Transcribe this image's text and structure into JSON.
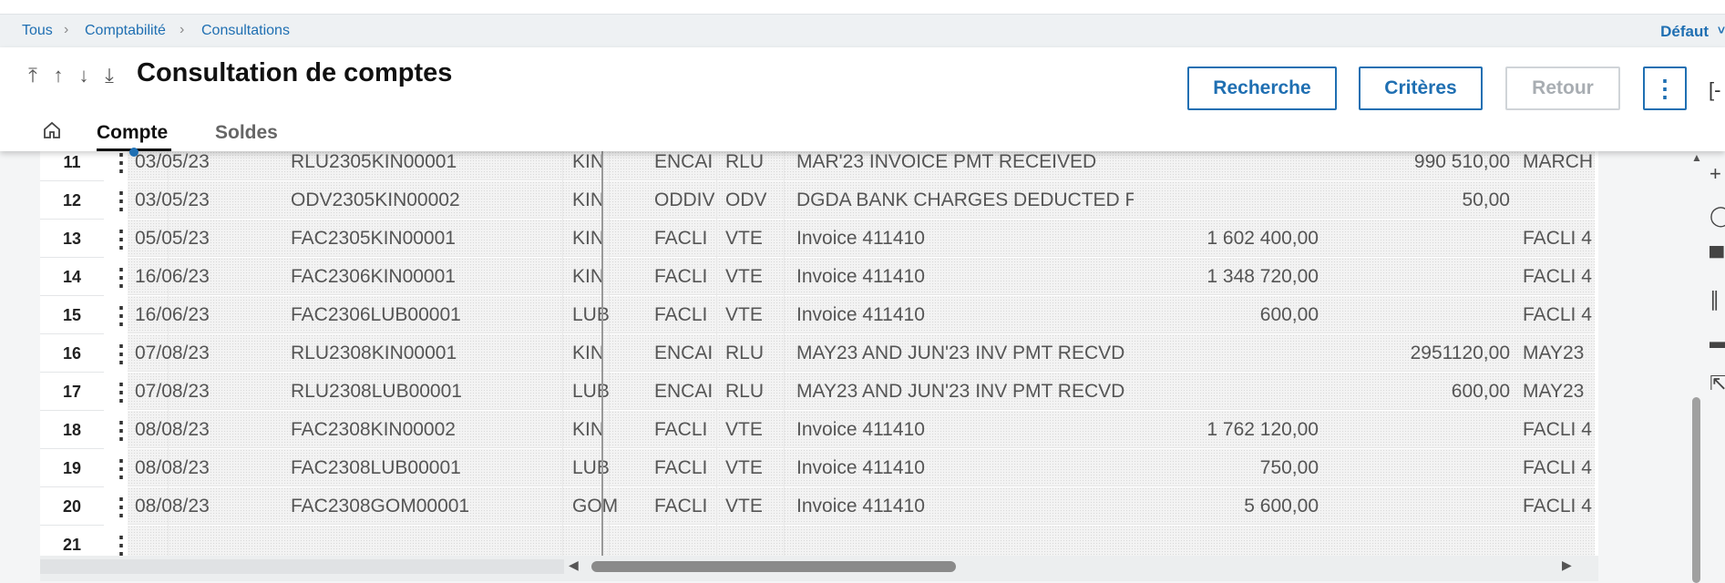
{
  "breadcrumb": [
    "Tous",
    "Comptabilité",
    "Consultations"
  ],
  "default_label": "Défaut",
  "page_title": "Consultation de comptes",
  "nav_arrows": [
    "⤒",
    "↑",
    "↓",
    "⤓"
  ],
  "buttons": {
    "search": "Recherche",
    "criteria": "Critères",
    "back": "Retour"
  },
  "tabs": [
    {
      "label": "Compte"
    },
    {
      "label": "Soldes"
    }
  ],
  "rows": [
    {
      "num": "11",
      "date": "03/05/23",
      "piece": "RLU2305KIN00001",
      "site": "KIN",
      "journal": "ENCAI",
      "type": "RLU",
      "label": "MAR'23 INVOICE PMT RECEIVED",
      "debit": "",
      "credit": "990 510,00",
      "ref": "MARCH"
    },
    {
      "num": "12",
      "date": "03/05/23",
      "piece": "ODV2305KIN00002",
      "site": "KIN",
      "journal": "ODDIV",
      "type": "ODV",
      "label": "DGDA BANK CHARGES DEDUCTED FR",
      "debit": "",
      "credit": "50,00",
      "ref": ""
    },
    {
      "num": "13",
      "date": "05/05/23",
      "piece": "FAC2305KIN00001",
      "site": "KIN",
      "journal": "FACLI",
      "type": "VTE",
      "label": "Invoice 411410",
      "debit": "1 602 400,00",
      "credit": "",
      "ref": "FACLI 4"
    },
    {
      "num": "14",
      "date": "16/06/23",
      "piece": "FAC2306KIN00001",
      "site": "KIN",
      "journal": "FACLI",
      "type": "VTE",
      "label": "Invoice 411410",
      "debit": "1 348 720,00",
      "credit": "",
      "ref": "FACLI 4"
    },
    {
      "num": "15",
      "date": "16/06/23",
      "piece": "FAC2306LUB00001",
      "site": "LUB",
      "journal": "FACLI",
      "type": "VTE",
      "label": "Invoice 411410",
      "debit": "600,00",
      "credit": "",
      "ref": "FACLI 4"
    },
    {
      "num": "16",
      "date": "07/08/23",
      "piece": "RLU2308KIN00001",
      "site": "KIN",
      "journal": "ENCAI",
      "type": "RLU",
      "label": "MAY23 AND JUN'23 INV PMT RECVD",
      "debit": "",
      "credit": "2951120,00",
      "ref": "MAY23"
    },
    {
      "num": "17",
      "date": "07/08/23",
      "piece": "RLU2308LUB00001",
      "site": "LUB",
      "journal": "ENCAI",
      "type": "RLU",
      "label": "MAY23 AND JUN'23 INV PMT RECVD",
      "debit": "",
      "credit": "600,00",
      "ref": "MAY23"
    },
    {
      "num": "18",
      "date": "08/08/23",
      "piece": "FAC2308KIN00002",
      "site": "KIN",
      "journal": "FACLI",
      "type": "VTE",
      "label": "Invoice 411410",
      "debit": "1 762 120,00",
      "credit": "",
      "ref": "FACLI 4"
    },
    {
      "num": "19",
      "date": "08/08/23",
      "piece": "FAC2308LUB00001",
      "site": "LUB",
      "journal": "FACLI",
      "type": "VTE",
      "label": "Invoice 411410",
      "debit": "750,00",
      "credit": "",
      "ref": "FACLI 4"
    },
    {
      "num": "20",
      "date": "08/08/23",
      "piece": "FAC2308GOM00001",
      "site": "GOM",
      "journal": "FACLI",
      "type": "VTE",
      "label": "Invoice 411410",
      "debit": "5 600,00",
      "credit": "",
      "ref": "FACLI 4"
    },
    {
      "num": "21",
      "date": "",
      "piece": "",
      "site": "",
      "journal": "",
      "type": "",
      "label": "",
      "debit": "",
      "credit": "",
      "ref": ""
    }
  ],
  "right_rail_icons": [
    "add-icon",
    "refresh-icon",
    "print-icon",
    "attachment-icon",
    "comment-icon",
    "export-icon"
  ],
  "colors": {
    "accent": "#1f6fb2",
    "disabled": "#a8adb2"
  }
}
